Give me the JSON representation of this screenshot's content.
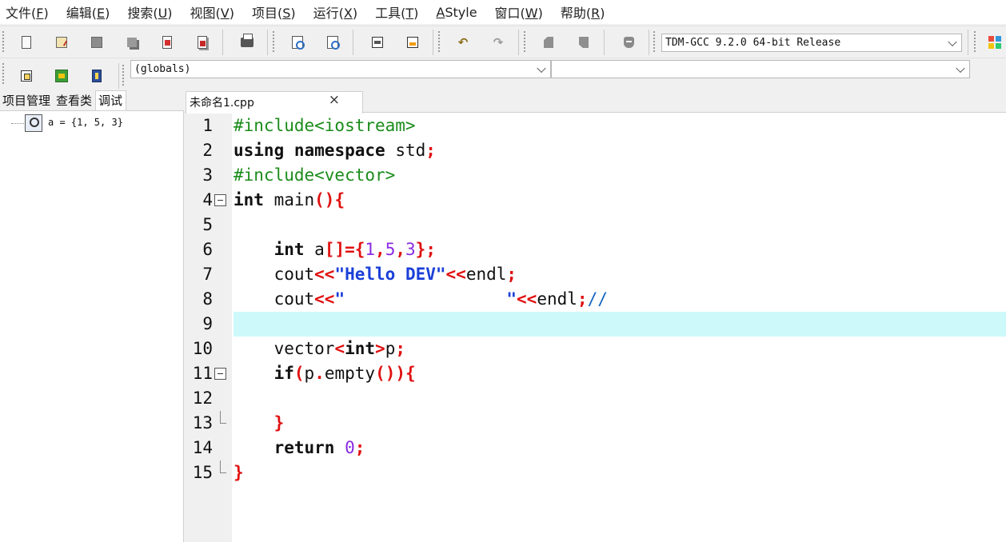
{
  "menu": [
    {
      "label": "文件",
      "accel": "(F)",
      "accel_underline": "F"
    },
    {
      "label": "编辑",
      "accel": "(E)",
      "accel_underline": "E"
    },
    {
      "label": "搜索",
      "accel": "(U)",
      "accel_underline": "U"
    },
    {
      "label": "视图",
      "accel": "(V)",
      "accel_underline": "V"
    },
    {
      "label": "项目",
      "accel": "(S)",
      "accel_underline": "S"
    },
    {
      "label": "运行",
      "accel": "(X)",
      "accel_underline": "X"
    },
    {
      "label": "工具",
      "accel": "(T)",
      "accel_underline": "T"
    },
    {
      "label": "AStyle",
      "accel": "",
      "accel_underline": "A"
    },
    {
      "label": "窗口",
      "accel": "(W)",
      "accel_underline": "W"
    },
    {
      "label": "帮助",
      "accel": "(R)",
      "accel_underline": "R"
    }
  ],
  "toolbar": {
    "compiler": "TDM-GCC 9.2.0 64-bit Release",
    "scope": "(globals)",
    "symbol": ""
  },
  "left_panel": {
    "tabs": [
      "项目管理",
      "查看类",
      "调试"
    ],
    "active_tab": "调试",
    "watch": "a = {1, 5, 3}"
  },
  "editor": {
    "tab_title": "未命名1.cpp",
    "current_line": 9,
    "colors": {
      "keyword": "#111111",
      "preprocessor": "#1a8c1a",
      "operator": "#e01010",
      "number": "#8a2be2",
      "string": "#1a3fd8",
      "comment": "#1565c0",
      "current_line_bg": "#cdf9fb"
    },
    "lines": [
      {
        "n": "1",
        "tokens": [
          {
            "t": "#include<iostream>",
            "c": "pp"
          }
        ]
      },
      {
        "n": "2",
        "tokens": [
          {
            "t": "using",
            "c": "kw"
          },
          {
            "t": " ",
            "c": "plain"
          },
          {
            "t": "namespace",
            "c": "kw"
          },
          {
            "t": " std",
            "c": "plain"
          },
          {
            "t": ";",
            "c": "op"
          }
        ]
      },
      {
        "n": "3",
        "tokens": [
          {
            "t": "#include<vector>",
            "c": "pp"
          }
        ]
      },
      {
        "n": "4",
        "fold": "open",
        "tokens": [
          {
            "t": "int",
            "c": "kw"
          },
          {
            "t": " main",
            "c": "plain"
          },
          {
            "t": "(){",
            "c": "op"
          }
        ]
      },
      {
        "n": "5",
        "tokens": []
      },
      {
        "n": "6",
        "tokens": [
          {
            "t": "    ",
            "c": "plain"
          },
          {
            "t": "int",
            "c": "kw"
          },
          {
            "t": " a",
            "c": "plain"
          },
          {
            "t": "[]={",
            "c": "op"
          },
          {
            "t": "1",
            "c": "num"
          },
          {
            "t": ",",
            "c": "op"
          },
          {
            "t": "5",
            "c": "num"
          },
          {
            "t": ",",
            "c": "op"
          },
          {
            "t": "3",
            "c": "num"
          },
          {
            "t": "};",
            "c": "op"
          }
        ]
      },
      {
        "n": "7",
        "tokens": [
          {
            "t": "    cout",
            "c": "plain"
          },
          {
            "t": "<<",
            "c": "op"
          },
          {
            "t": "\"Hello DEV\"",
            "c": "str"
          },
          {
            "t": "<<",
            "c": "op"
          },
          {
            "t": "endl",
            "c": "plain"
          },
          {
            "t": ";",
            "c": "op"
          }
        ]
      },
      {
        "n": "8",
        "tokens": [
          {
            "t": "    cout",
            "c": "plain"
          },
          {
            "t": "<<",
            "c": "op"
          },
          {
            "t": "\"                \"",
            "c": "str"
          },
          {
            "t": "<<",
            "c": "op"
          },
          {
            "t": "endl",
            "c": "plain"
          },
          {
            "t": ";",
            "c": "op"
          },
          {
            "t": "//",
            "c": "cm"
          }
        ]
      },
      {
        "n": "9",
        "tokens": []
      },
      {
        "n": "10",
        "tokens": [
          {
            "t": "    vector",
            "c": "plain"
          },
          {
            "t": "<",
            "c": "op"
          },
          {
            "t": "int",
            "c": "kw"
          },
          {
            "t": ">",
            "c": "op"
          },
          {
            "t": "p",
            "c": "plain"
          },
          {
            "t": ";",
            "c": "op"
          }
        ]
      },
      {
        "n": "11",
        "fold": "open",
        "tokens": [
          {
            "t": "    ",
            "c": "plain"
          },
          {
            "t": "if",
            "c": "kw"
          },
          {
            "t": "(",
            "c": "op"
          },
          {
            "t": "p",
            "c": "plain"
          },
          {
            "t": ".",
            "c": "op"
          },
          {
            "t": "empty",
            "c": "plain"
          },
          {
            "t": "()){",
            "c": "op"
          }
        ]
      },
      {
        "n": "12",
        "tokens": []
      },
      {
        "n": "13",
        "fold": "end",
        "tokens": [
          {
            "t": "    ",
            "c": "plain"
          },
          {
            "t": "}",
            "c": "op"
          }
        ]
      },
      {
        "n": "14",
        "tokens": [
          {
            "t": "    ",
            "c": "plain"
          },
          {
            "t": "return",
            "c": "kw"
          },
          {
            "t": " ",
            "c": "plain"
          },
          {
            "t": "0",
            "c": "num"
          },
          {
            "t": ";",
            "c": "op"
          }
        ]
      },
      {
        "n": "15",
        "fold": "end",
        "tokens": [
          {
            "t": "}",
            "c": "op"
          }
        ]
      }
    ]
  }
}
